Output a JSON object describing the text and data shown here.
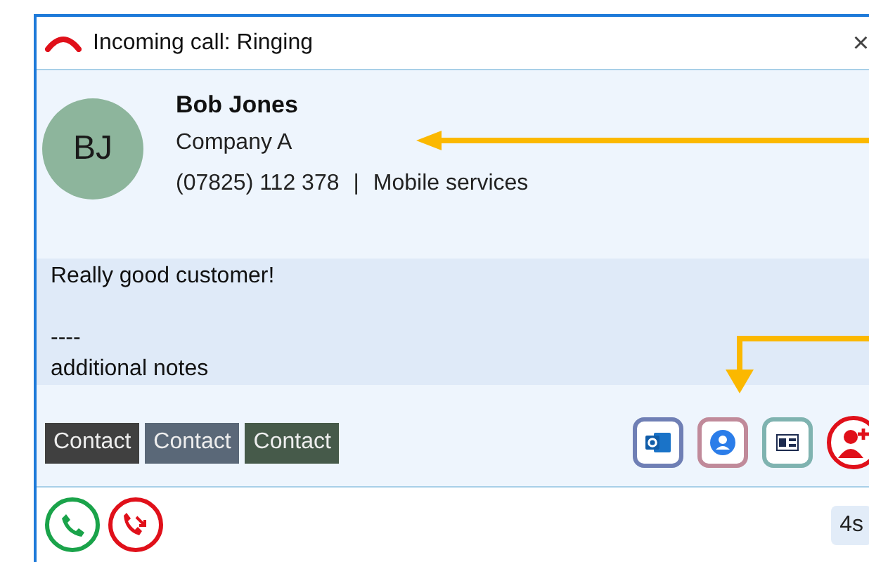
{
  "window": {
    "title": "Incoming call: Ringing",
    "close": "×"
  },
  "caller": {
    "initials": "BJ",
    "name": "Bob Jones",
    "company": "Company A",
    "phone": "(07825) 112 378",
    "separator": "|",
    "service": "Mobile services"
  },
  "notes": "Really good customer!\n\n----\nadditional notes",
  "tags": [
    {
      "label": "Contact",
      "color": "#404040"
    },
    {
      "label": "Contact",
      "color": "#5a6878"
    },
    {
      "label": "Contact",
      "color": "#465a4a"
    }
  ],
  "actions": [
    {
      "kind": "outlook",
      "color": "#6f7fb5"
    },
    {
      "kind": "person",
      "color": "#c08a9a"
    },
    {
      "kind": "card",
      "color": "#7fb3b0"
    },
    {
      "kind": "add",
      "color": "#e0101a"
    }
  ],
  "duration": "4s"
}
